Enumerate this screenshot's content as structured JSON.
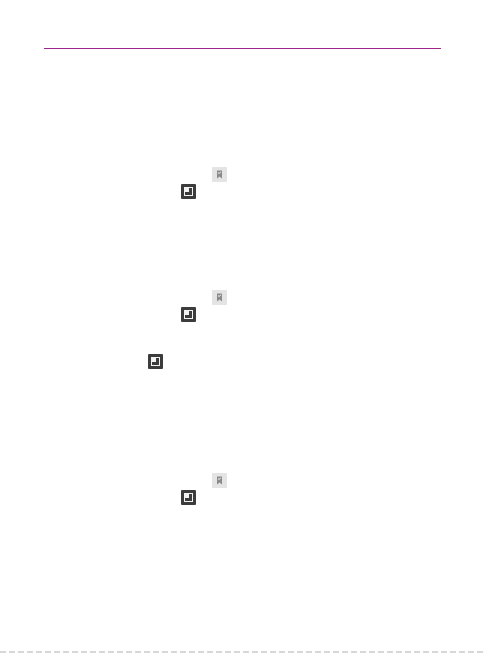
{
  "header": {
    "rule_color": "#a0258c"
  },
  "icons": [
    {
      "group": 1,
      "name": "bookmark-icon",
      "style": "light"
    },
    {
      "group": 1,
      "name": "new-window-icon",
      "style": "dark"
    },
    {
      "group": 2,
      "name": "bookmark-icon",
      "style": "light"
    },
    {
      "group": 2,
      "name": "new-window-icon",
      "style": "dark"
    },
    {
      "group": 2,
      "name": "new-window-icon",
      "style": "dark"
    },
    {
      "group": 3,
      "name": "bookmark-icon",
      "style": "light"
    },
    {
      "group": 3,
      "name": "new-window-icon",
      "style": "dark"
    }
  ],
  "colors": {
    "accent": "#a0258c",
    "icon_light_bg": "#e4e4e4",
    "icon_dark_bg": "#3c3c3c"
  }
}
